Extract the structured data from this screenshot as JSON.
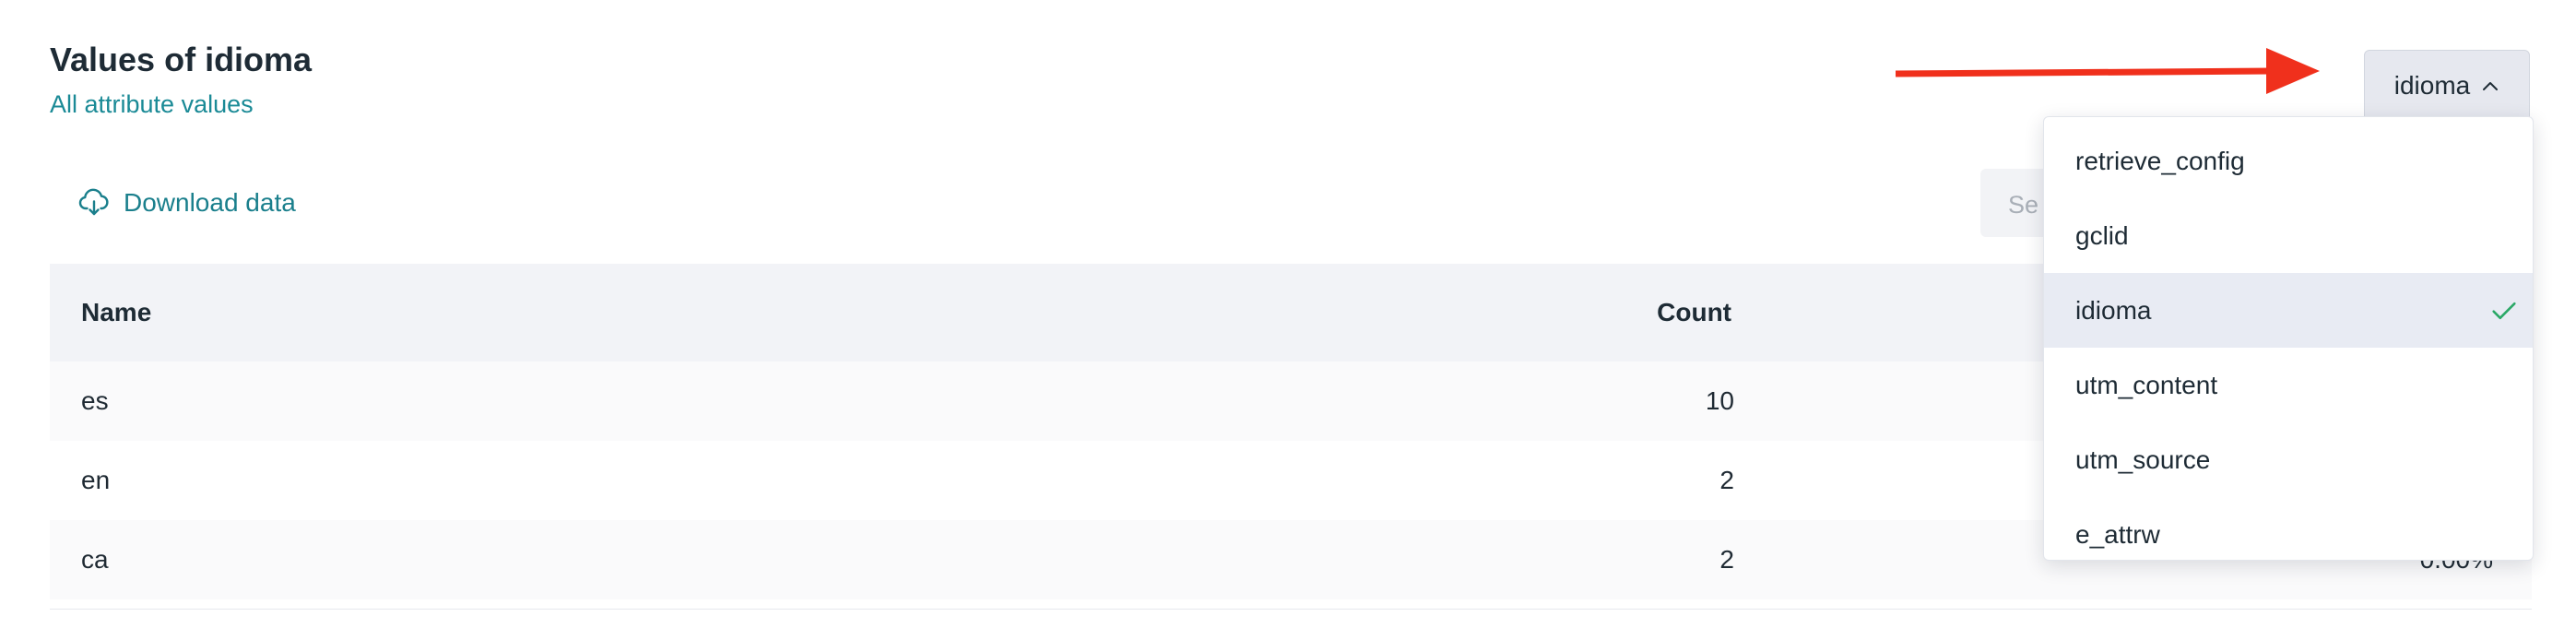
{
  "header": {
    "title": "Values of idioma",
    "subtitle_link": "All attribute values"
  },
  "toolbar": {
    "download_label": "Download data",
    "download_icon": "cloud-download-icon",
    "search_placeholder": "Se"
  },
  "table": {
    "columns": [
      "Name",
      "Count"
    ],
    "rows": [
      {
        "name": "es",
        "count": "10",
        "percent": ""
      },
      {
        "name": "en",
        "count": "2",
        "percent": ""
      },
      {
        "name": "ca",
        "count": "2",
        "percent": "0.00%"
      }
    ]
  },
  "attribute_select": {
    "selected": "idioma",
    "icon": "chevron-up-icon",
    "options": [
      {
        "label": "retrieve_config",
        "selected": false
      },
      {
        "label": "gclid",
        "selected": false
      },
      {
        "label": "idioma",
        "selected": true
      },
      {
        "label": "utm_content",
        "selected": false
      },
      {
        "label": "utm_source",
        "selected": false
      },
      {
        "label": "e_attrw",
        "selected": false
      }
    ]
  },
  "annotation": {
    "arrow_color": "#f0301c"
  },
  "colors": {
    "accent": "#1a8a96",
    "check": "#2aa866"
  }
}
